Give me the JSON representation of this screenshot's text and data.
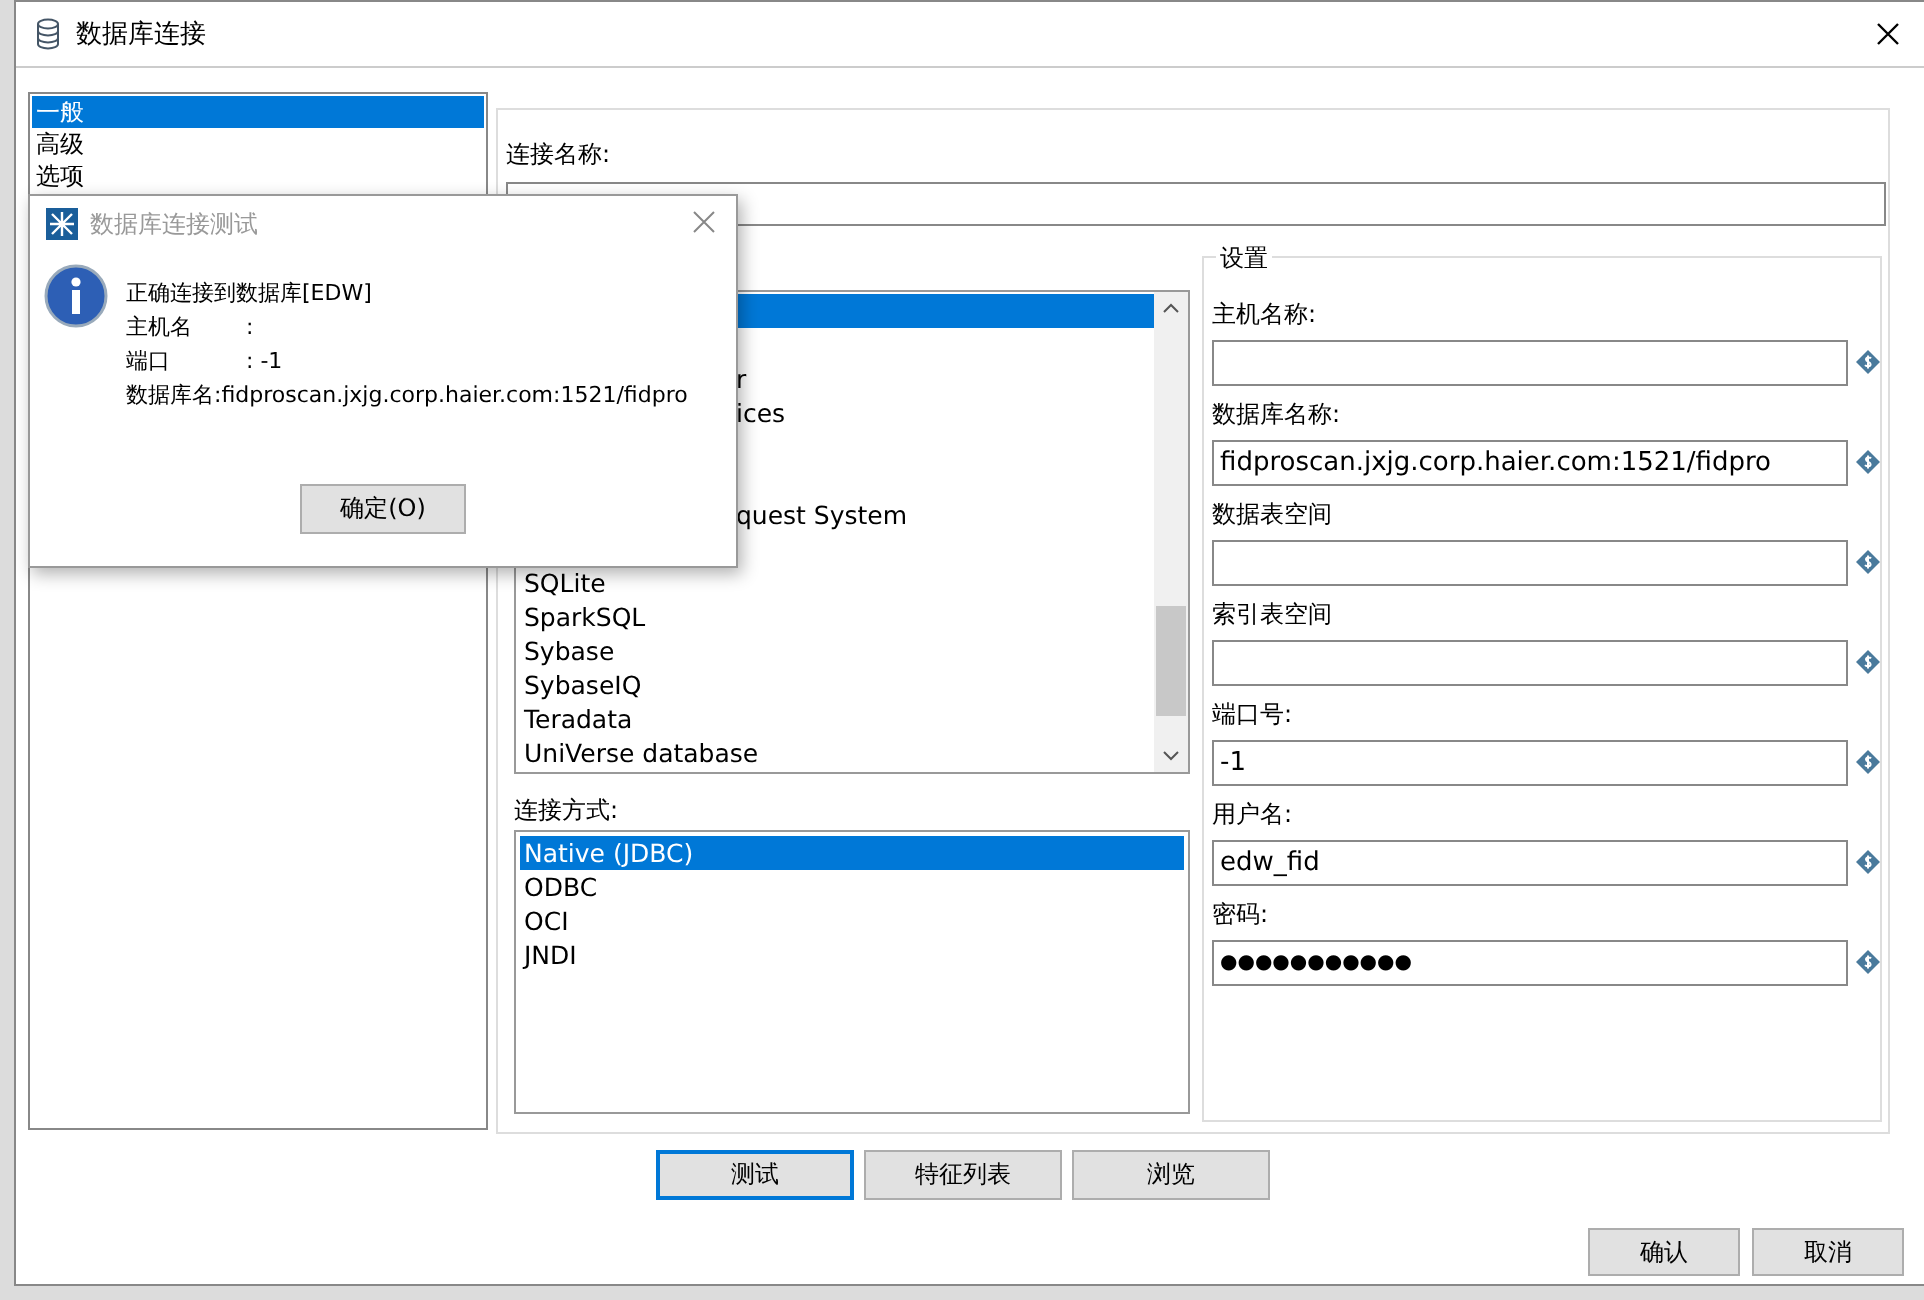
{
  "window": {
    "title": "数据库连接"
  },
  "sidebar": {
    "items": [
      {
        "label": "一般",
        "selected": true
      },
      {
        "label": "高级",
        "selected": false
      },
      {
        "label": "选项",
        "selected": false
      }
    ]
  },
  "connection_name": {
    "label": "连接名称:"
  },
  "db_types": {
    "items": [
      {
        "kind": "full",
        "selected": true
      },
      {
        "kind": "full",
        "selected": false
      },
      {
        "label": "r",
        "kind": "clipped",
        "selected": false
      },
      {
        "label": "ices",
        "kind": "clipped",
        "selected": false
      },
      {
        "kind": "full",
        "selected": false
      },
      {
        "kind": "full",
        "selected": false
      },
      {
        "label": "quest System",
        "kind": "clipped",
        "selected": false
      },
      {
        "kind": "full",
        "selected": false
      },
      {
        "label": "SQLite",
        "kind": "full",
        "selected": false
      },
      {
        "label": "SparkSQL",
        "kind": "full",
        "selected": false
      },
      {
        "label": "Sybase",
        "kind": "full",
        "selected": false
      },
      {
        "label": "SybaseIQ",
        "kind": "full",
        "selected": false
      },
      {
        "label": "Teradata",
        "kind": "full",
        "selected": false
      },
      {
        "label": "UniVerse database",
        "kind": "full",
        "selected": false
      }
    ]
  },
  "access": {
    "label": "连接方式:",
    "items": [
      {
        "label": "Native (JDBC)",
        "selected": true
      },
      {
        "label": "ODBC",
        "selected": false
      },
      {
        "label": "OCI",
        "selected": false
      },
      {
        "label": "JNDI",
        "selected": false
      }
    ]
  },
  "settings": {
    "title": "设置",
    "fields": [
      {
        "label": "主机名称:"
      },
      {
        "label": "数据库名称:",
        "value": "fidproscan.jxjg.corp.haier.com:1521/fidpro"
      },
      {
        "label": "数据表空间"
      },
      {
        "label": "索引表空间"
      },
      {
        "label": "端口号:",
        "value": "-1"
      },
      {
        "label": "用户名:",
        "value": "edw_fid"
      },
      {
        "label": "密码:",
        "value": "●●●●●●●●●●●",
        "kind": "password"
      }
    ]
  },
  "buttons": [
    "测试",
    "特征列表",
    "浏览"
  ],
  "footer_buttons": [
    "确认",
    "取消"
  ],
  "popup": {
    "title": "数据库连接测试",
    "lines": [
      {
        "label": "正确连接到数据库[EDW]"
      },
      {
        "label": "主机名",
        "value": ":"
      },
      {
        "label": "端口",
        "value": ": -1"
      },
      {
        "label": "数据库名:fidproscan.jxjg.corp.haier.com:1521/fidpro"
      }
    ],
    "button": "确定(O)"
  }
}
